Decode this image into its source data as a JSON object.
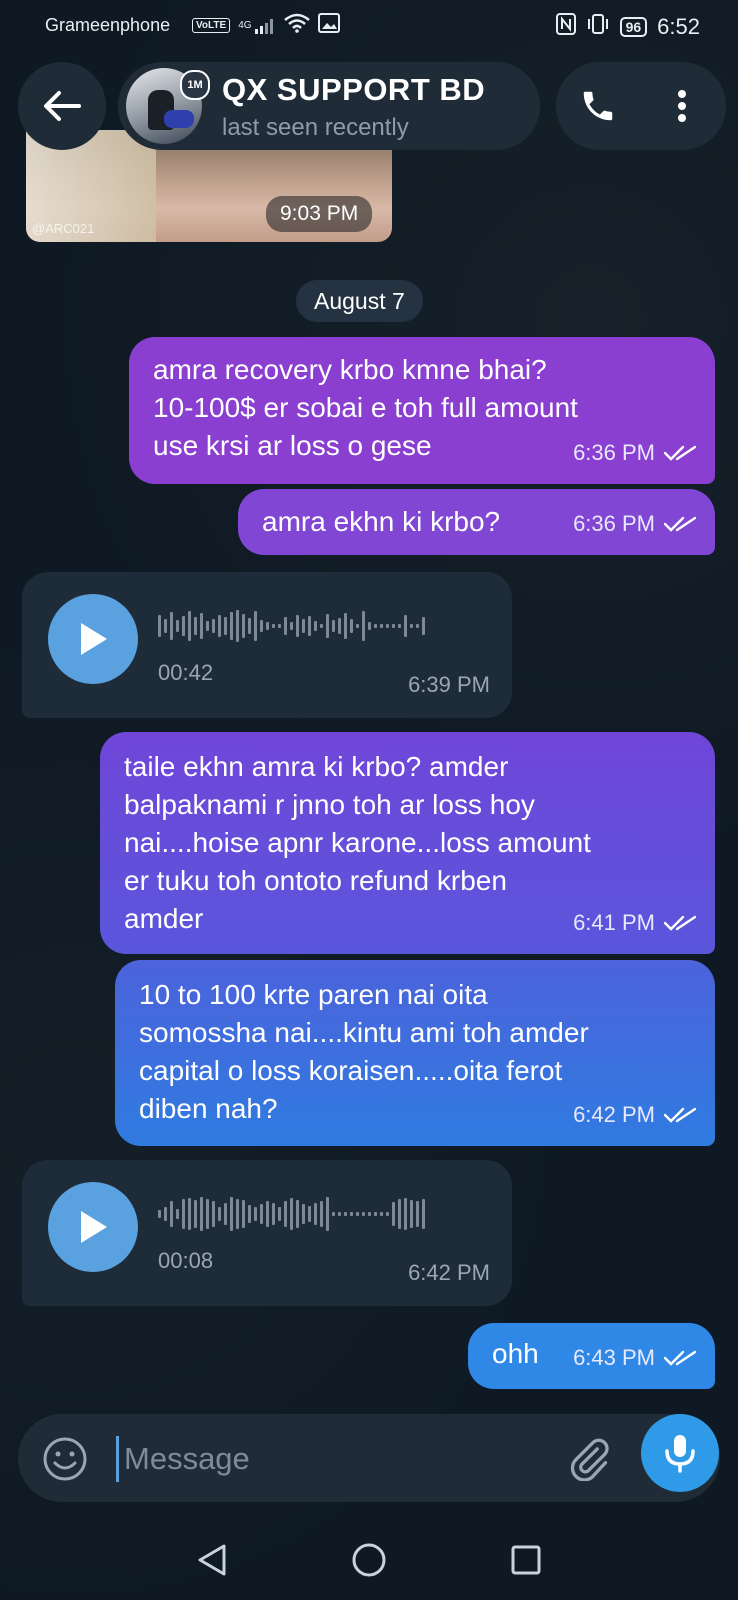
{
  "status_bar": {
    "carrier": "Grameenphone",
    "volte": "VoLTE",
    "network": "4G",
    "battery": "96",
    "time": "6:52"
  },
  "media": {
    "watermark": "@ARC021",
    "time": "9:03 PM"
  },
  "header": {
    "title": "QX SUPPORT BD",
    "subtitle": "last seen recently",
    "avatar_badge": "1M"
  },
  "date_chip": "August 7",
  "messages": [
    {
      "type": "text",
      "direction": "out",
      "text_lines": [
        "amra recovery krbo kmne bhai?",
        "10-100$ er sobai e toh full amount",
        "use krsi ar loss o gese"
      ],
      "time": "6:36 PM",
      "status": "read"
    },
    {
      "type": "text",
      "direction": "out",
      "text_lines": [
        "amra ekhn ki krbo?"
      ],
      "time": "6:36 PM",
      "status": "read"
    },
    {
      "type": "voice",
      "direction": "in",
      "duration": "00:42",
      "time": "6:39 PM"
    },
    {
      "type": "text",
      "direction": "out",
      "text_lines": [
        "taile ekhn amra ki krbo? amder",
        "balpaknami r jnno toh ar loss hoy",
        "nai....hoise apnr karone...loss amount",
        "er tuku toh ontoto refund krben",
        "amder"
      ],
      "time": "6:41 PM",
      "status": "read"
    },
    {
      "type": "text",
      "direction": "out",
      "text_lines": [
        "10 to 100 krte paren nai oita",
        "somossha nai....kintu ami toh amder",
        "capital o loss koraisen.....oita ferot",
        "diben nah?"
      ],
      "time": "6:42 PM",
      "status": "read"
    },
    {
      "type": "voice",
      "direction": "in",
      "duration": "00:08",
      "time": "6:42 PM"
    },
    {
      "type": "text",
      "direction": "out",
      "text_lines": [
        "ohh"
      ],
      "time": "6:43 PM",
      "status": "read"
    }
  ],
  "composer": {
    "placeholder": "Message"
  },
  "colors": {
    "accent": "#2f9be8",
    "incoming_bubble": "#1e2b38",
    "header_pill": "#1f2c38",
    "outgoing_purple": "#8a3fd0",
    "outgoing_blue": "#2f7be0"
  }
}
